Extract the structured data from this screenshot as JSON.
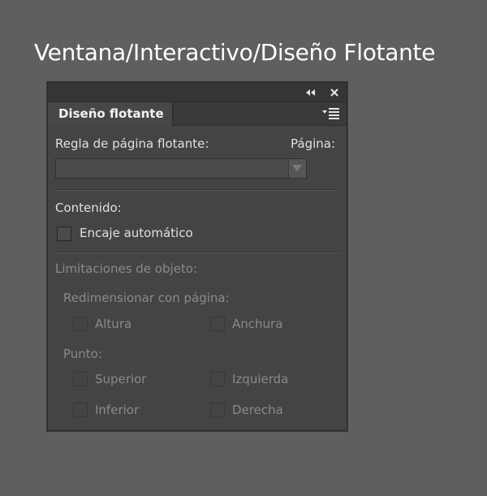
{
  "caption": "Ventana/Interactivo/Diseño Flotante",
  "panel": {
    "tab_label": "Diseño flotante",
    "collapse_glyph": "◂◂",
    "close_glyph": "✕",
    "rule_label": "Regla de página flotante:",
    "page_label": "Página:",
    "rule_select_value": "",
    "content_label": "Contenido:",
    "auto_fit_label": "Encaje automático",
    "constraints_label": "Limitaciones de objeto:",
    "resize_label": "Redimensionar con página:",
    "height_label": "Altura",
    "width_label": "Anchura",
    "pin_label": "Punto:",
    "top_label": "Superior",
    "left_label": "Izquierda",
    "bottom_label": "Inferior",
    "right_label": "Derecha"
  },
  "icons": {
    "collapse": "double-chevron-left-icon",
    "close": "close-icon",
    "panel_menu": "panel-menu-icon",
    "dropdown": "chevron-down-icon"
  },
  "colors": {
    "background": "#5f5f5f",
    "panel": "#444444",
    "text": "#e0e0e0",
    "disabled_text": "#8a8a8a"
  }
}
